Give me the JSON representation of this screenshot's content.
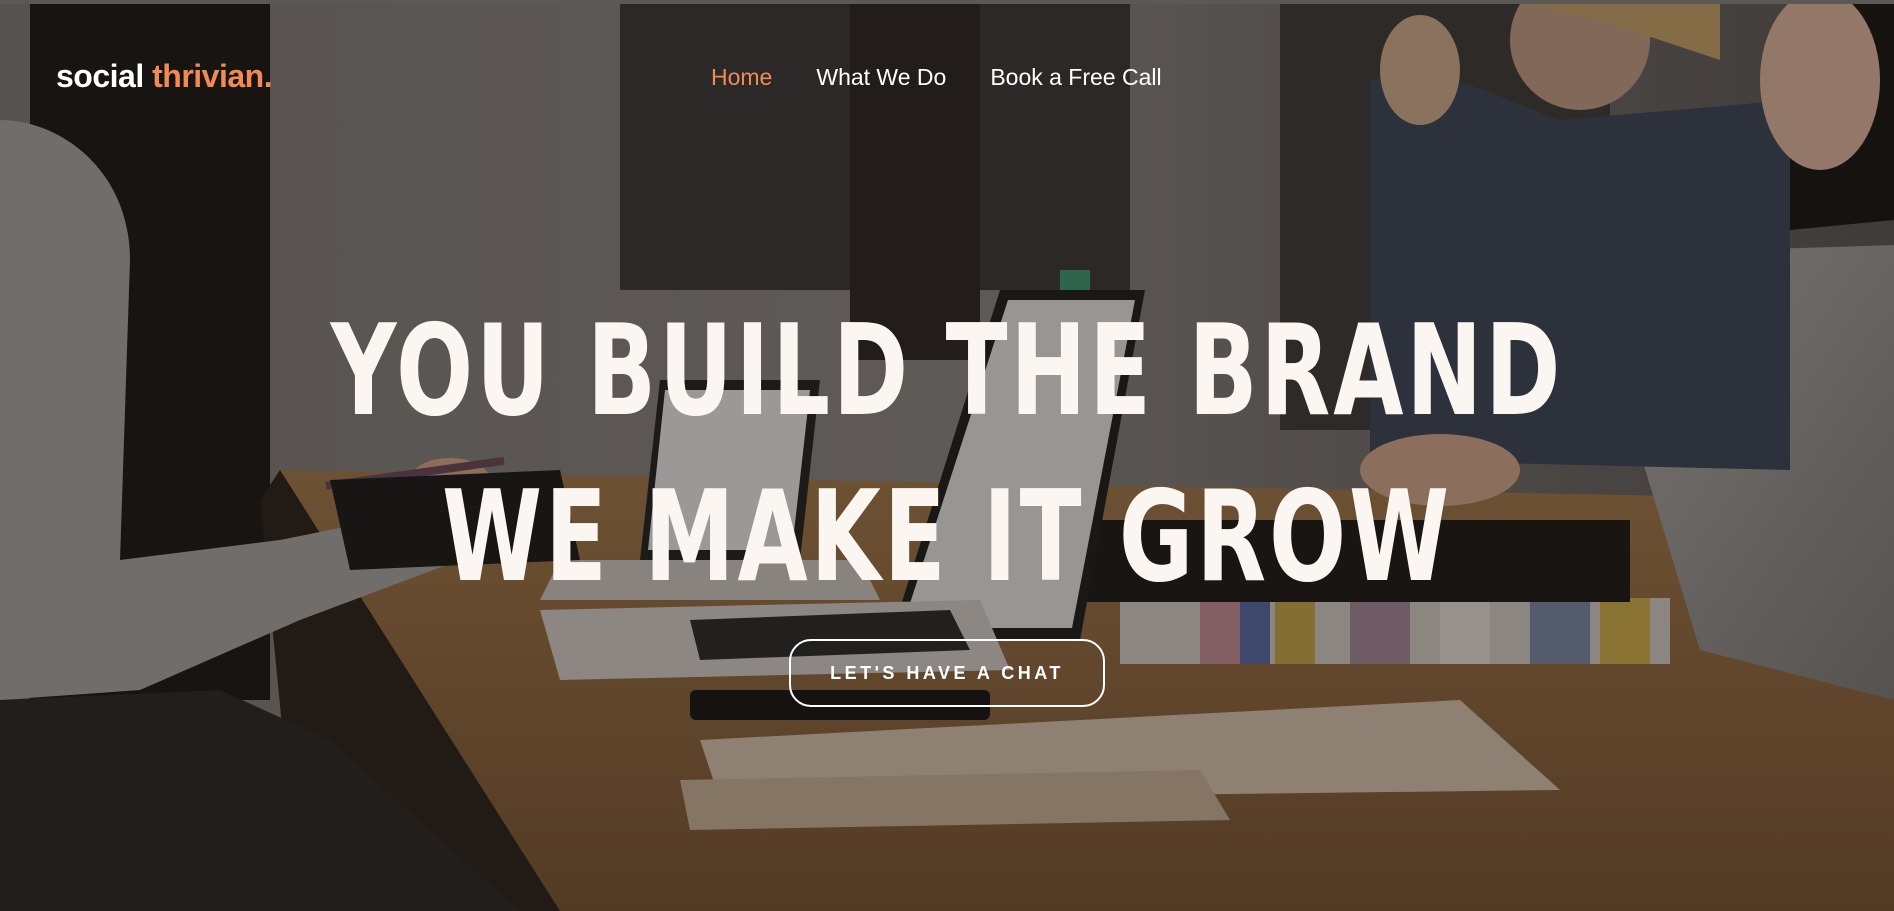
{
  "brand": {
    "part1": "social",
    "part2": "thrivian.",
    "accent_color": "#f08a57"
  },
  "nav": {
    "items": [
      {
        "label": "Home",
        "active": true
      },
      {
        "label": "What We Do",
        "active": false
      },
      {
        "label": "Book a Free Call",
        "active": false
      }
    ]
  },
  "hero": {
    "headline_line1": "YOU BUILD THE BRAND",
    "headline_line2": "WE MAKE IT GROW",
    "cta_label": "LET'S HAVE A CHAT",
    "background_image": "office-meeting-photo"
  }
}
